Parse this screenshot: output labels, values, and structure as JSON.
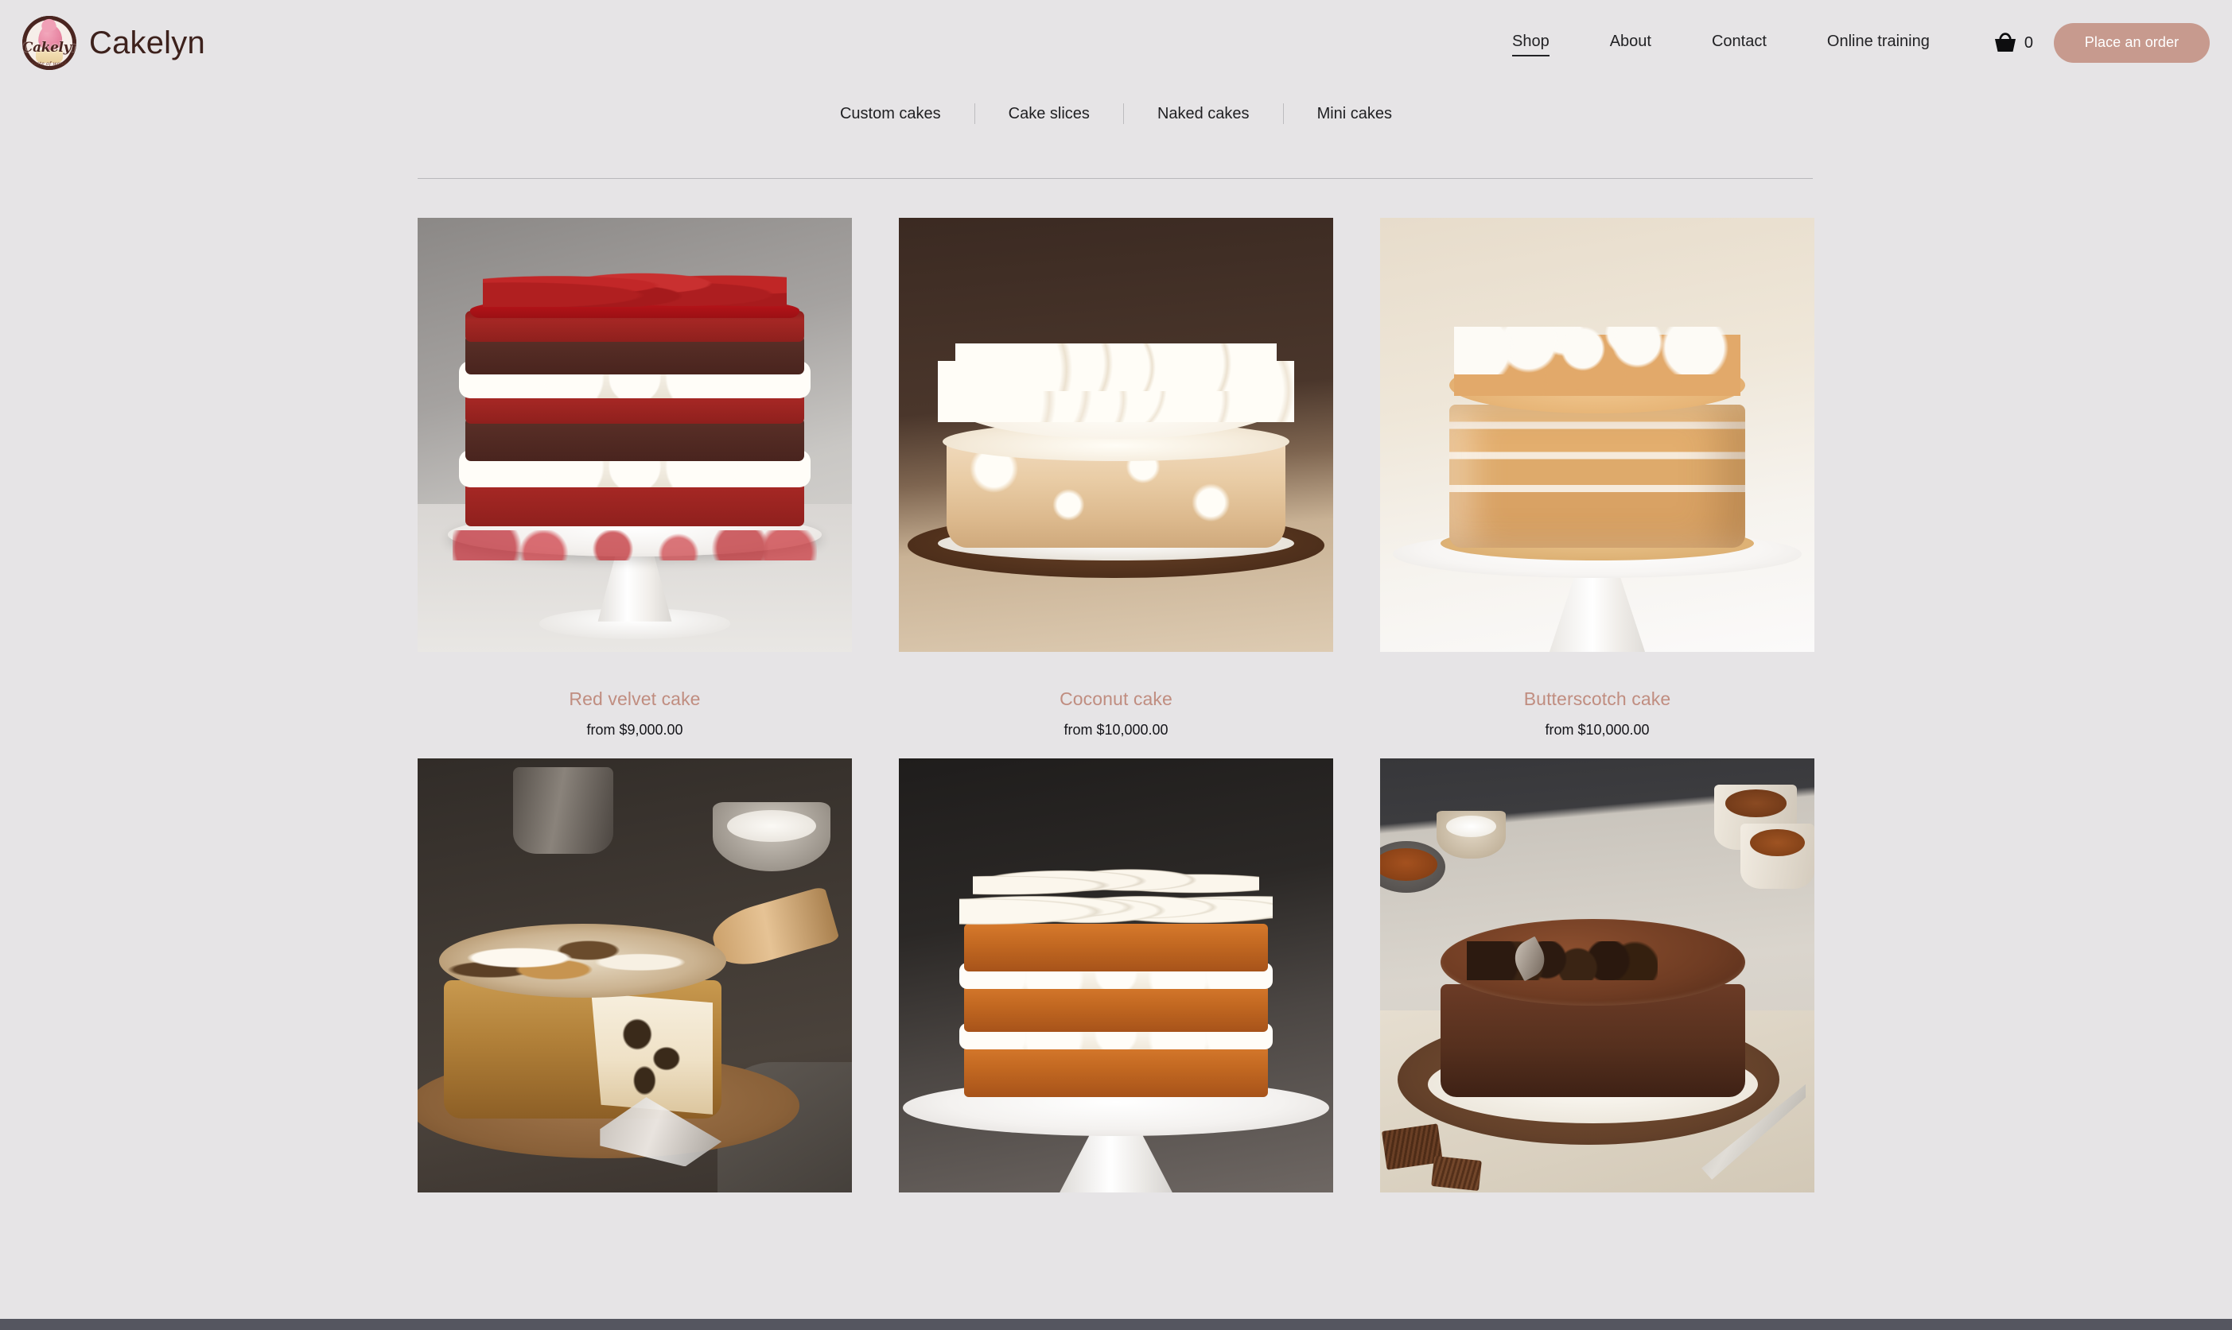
{
  "brand": {
    "name": "Cakelyn",
    "logo_script": "Cakelyn",
    "logo_tagline": "A taste of wonder"
  },
  "colors": {
    "page_background": "#e6e4e6",
    "accent_rose": "#c79a8e",
    "product_title": "#c08d80",
    "text_dark": "#1f1f22",
    "divider": "#b9b8bb",
    "bottom_bar": "#555660"
  },
  "header": {
    "nav": [
      {
        "label": "Shop",
        "active": true
      },
      {
        "label": "About",
        "active": false
      },
      {
        "label": "Contact",
        "active": false
      },
      {
        "label": "Online training",
        "active": false
      }
    ],
    "cart": {
      "icon": "shopping-basket-icon",
      "count": "0"
    },
    "cta_label": "Place an order"
  },
  "subnav": {
    "items": [
      {
        "label": "Custom cakes"
      },
      {
        "label": "Cake slices"
      },
      {
        "label": "Naked cakes"
      },
      {
        "label": "Mini cakes"
      }
    ]
  },
  "products": [
    {
      "title": "Red velvet cake",
      "price": "from $9,000.00",
      "image_alt": "Red velvet layer cake with cream filling on a white pedestal stand"
    },
    {
      "title": "Coconut cake",
      "price": "from $10,000.00",
      "image_alt": "Coconut cake with whipped cream rosettes on a dark wooden board"
    },
    {
      "title": "Butterscotch cake",
      "price": "from $10,000.00",
      "image_alt": "Butterscotch striped buttercream cake with piped swirls on a white cake stand"
    },
    {
      "title": "",
      "price": "",
      "image_alt": "Marble swirl cake with a slice removed on a wooden board"
    },
    {
      "title": "",
      "price": "",
      "image_alt": "Carrot layer cake with cream cheese frosting on a white cake stand"
    },
    {
      "title": "",
      "price": "",
      "image_alt": "Chocolate ganache cake with coffee beans on a wooden board"
    }
  ]
}
